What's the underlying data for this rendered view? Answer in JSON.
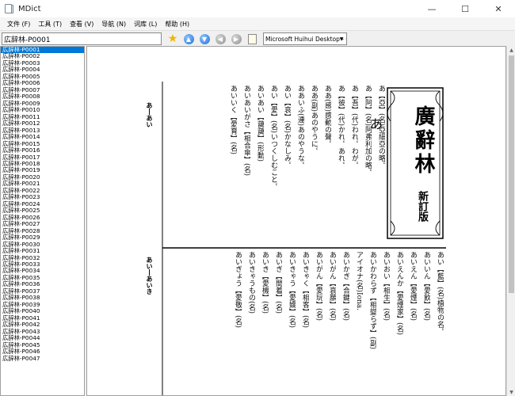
{
  "window": {
    "title": "MDict",
    "minimize": "—",
    "maximize": "☐",
    "close": "✕"
  },
  "menu": [
    "文件 (F)",
    "工具 (T)",
    "查看 (V)",
    "导航 (N)",
    "词库 (L)",
    "帮助 (H)"
  ],
  "search": {
    "value": "広辞林-P0001"
  },
  "toolbar": {
    "font": "Microsoft Huihui Desktop - C",
    "dropdown_arrow": "▼"
  },
  "sidebar": {
    "items": [
      "広辞林-P0001",
      "広辞林-P0002",
      "広辞林-P0003",
      "広辞林-P0004",
      "広辞林-P0005",
      "広辞林-P0006",
      "広辞林-P0007",
      "広辞林-P0008",
      "広辞林-P0009",
      "広辞林-P0010",
      "広辞林-P0011",
      "広辞林-P0012",
      "広辞林-P0013",
      "広辞林-P0014",
      "広辞林-P0015",
      "広辞林-P0016",
      "広辞林-P0017",
      "広辞林-P0018",
      "広辞林-P0019",
      "広辞林-P0020",
      "広辞林-P0021",
      "広辞林-P0022",
      "広辞林-P0023",
      "広辞林-P0024",
      "広辞林-P0025",
      "広辞林-P0026",
      "広辞林-P0027",
      "広辞林-P0028",
      "広辞林-P0029",
      "広辞林-P0030",
      "広辞林-P0031",
      "広辞林-P0032",
      "広辞林-P0033",
      "広辞林-P0034",
      "広辞林-P0035",
      "広辞林-P0036",
      "広辞林-P0037",
      "広辞林-P0038",
      "広辞林-P0039",
      "広辞林-P0040",
      "広辞林-P0041",
      "広辞林-P0042",
      "広辞林-P0043",
      "広辞林-P0044",
      "広辞林-P0045",
      "広辞林-P0046",
      "広辞林-P0047"
    ],
    "selected": 0
  },
  "page": {
    "title": "廣辭林",
    "edition": "新訂版",
    "kana_heading": "あ",
    "running_head_top": "あ―あい",
    "running_head_bottom": "あい―あいき",
    "top_entries": [
      "あ【亞】(名)亞細亞の略。",
      "あ【阿】(名)阿弗利加の略。",
      "あ【吾】(代)われ。わが。",
      "あ【彼】(代)かれ。あれ。",
      "ああ(感)感動の聲。",
      "ああ(副)あのやうに。",
      "ああいふ(連)あのやうな。",
      "あい【哀】(名)かなしみ。",
      "あい【愛】(名)いつくしむこと。",
      "あいあい【藹藹】(形動)",
      "あいあいがさ【相合傘】(名)",
      "あいいく【愛育】(名)"
    ],
    "bottom_entries": [
      "あい【藍】(名)植物の名。",
      "あいいん【愛飲】(名)",
      "あいえん【愛煙】(名)",
      "あいえんか【愛煙家】(名)",
      "あいおい【相生】(名)",
      "あいかわらず【相變らず】(副)",
      "アイオナ(名)Iona.",
      "あいかぎ【合鍵】(名)",
      "あいがん【哀願】(名)",
      "あいがん【愛玩】(名)",
      "あいきゃく【相客】(名)",
      "あいきゃう【愛嬌】(名)",
      "あいぎ【間着】(名)",
      "あいき【愛機】(名)",
      "あいきゃうもの(名)",
      "あいぎょう【愛敬】(名)"
    ]
  }
}
